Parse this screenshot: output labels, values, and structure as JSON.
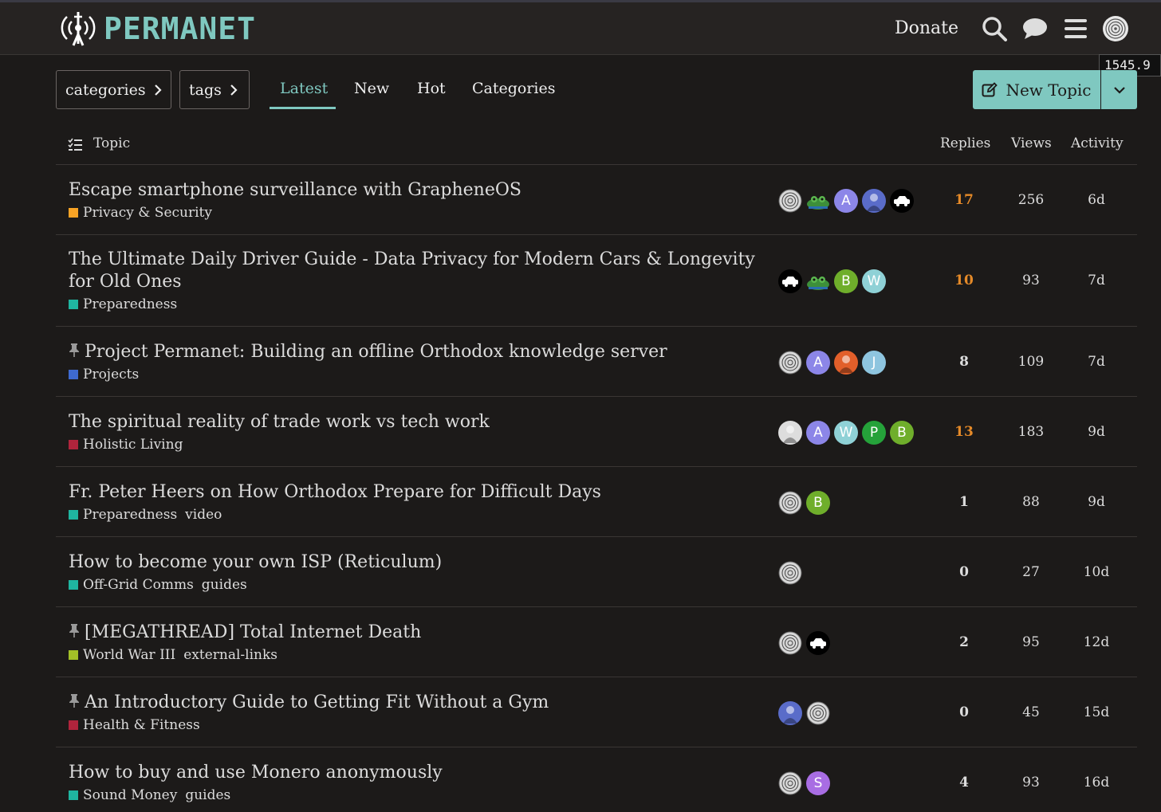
{
  "site": {
    "name": "PERMANET",
    "donate": "Donate",
    "tooltip": "1545.9"
  },
  "nav": {
    "categories_label": "categories",
    "tags_label": "tags",
    "tabs": [
      "Latest",
      "New",
      "Hot",
      "Categories"
    ],
    "active_tab": "Latest",
    "new_topic": "New Topic"
  },
  "table": {
    "headers": {
      "topic": "Topic",
      "replies": "Replies",
      "views": "Views",
      "activity": "Activity"
    },
    "topics": [
      {
        "title": "Escape smartphone surveillance with GrapheneOS",
        "category": "Privacy & Security",
        "cat_color": "#f7a325",
        "tags": [],
        "pinned": false,
        "replies": "17",
        "views": "256",
        "activity": "6d",
        "hot": true,
        "posters": [
          {
            "kind": "fp"
          },
          {
            "kind": "frog"
          },
          {
            "kind": "letter",
            "l": "A",
            "c": "#8c86e8"
          },
          {
            "kind": "img",
            "c": "#5a6cc9"
          },
          {
            "kind": "car"
          }
        ]
      },
      {
        "title": "The Ultimate Daily Driver Guide - Data Privacy for Modern Cars & Longevity for Old Ones",
        "category": "Preparedness",
        "cat_color": "#1fb5a0",
        "tags": [],
        "pinned": false,
        "replies": "10",
        "views": "93",
        "activity": "7d",
        "hot": true,
        "posters": [
          {
            "kind": "car"
          },
          {
            "kind": "frog"
          },
          {
            "kind": "letter",
            "l": "B",
            "c": "#6fae2b"
          },
          {
            "kind": "letter",
            "l": "W",
            "c": "#8fd1d6"
          }
        ]
      },
      {
        "title": "Project Permanet: Building an offline Orthodox knowledge server",
        "category": "Projects",
        "cat_color": "#3e6ad0",
        "tags": [],
        "pinned": true,
        "replies": "8",
        "views": "109",
        "activity": "7d",
        "hot": false,
        "posters": [
          {
            "kind": "fp"
          },
          {
            "kind": "letter",
            "l": "A",
            "c": "#8c86e8"
          },
          {
            "kind": "img",
            "c": "#e25f2a"
          },
          {
            "kind": "letter",
            "l": "J",
            "c": "#8ec5df"
          }
        ]
      },
      {
        "title": "The spiritual reality of trade work vs tech work",
        "category": "Holistic Living",
        "cat_color": "#b0243c",
        "tags": [],
        "pinned": false,
        "replies": "13",
        "views": "183",
        "activity": "9d",
        "hot": true,
        "posters": [
          {
            "kind": "img",
            "c": "#ddd"
          },
          {
            "kind": "letter",
            "l": "A",
            "c": "#8c86e8"
          },
          {
            "kind": "letter",
            "l": "W",
            "c": "#8fd1d6"
          },
          {
            "kind": "letter",
            "l": "P",
            "c": "#25a23a"
          },
          {
            "kind": "letter",
            "l": "B",
            "c": "#6fae2b"
          }
        ]
      },
      {
        "title": "Fr. Peter Heers on How Orthodox Prepare for Difficult Days",
        "category": "Preparedness",
        "cat_color": "#1fb5a0",
        "tags": [
          "video"
        ],
        "pinned": false,
        "replies": "1",
        "views": "88",
        "activity": "9d",
        "hot": false,
        "posters": [
          {
            "kind": "fp"
          },
          {
            "kind": "letter",
            "l": "B",
            "c": "#6fae2b"
          }
        ]
      },
      {
        "title": "How to become your own ISP (Reticulum)",
        "category": "Off-Grid Comms",
        "cat_color": "#1fb5a0",
        "tags": [
          "guides"
        ],
        "pinned": false,
        "replies": "0",
        "views": "27",
        "activity": "10d",
        "hot": false,
        "posters": [
          {
            "kind": "fp"
          }
        ]
      },
      {
        "title": "[MEGATHREAD] Total Internet Death",
        "category": "World War III",
        "cat_color": "#a3c027",
        "tags": [
          "external-links"
        ],
        "pinned": true,
        "replies": "2",
        "views": "95",
        "activity": "12d",
        "hot": false,
        "posters": [
          {
            "kind": "fp"
          },
          {
            "kind": "car"
          }
        ]
      },
      {
        "title": "An Introductory Guide to Getting Fit Without a Gym",
        "category": "Health & Fitness",
        "cat_color": "#b0243c",
        "tags": [],
        "pinned": true,
        "replies": "0",
        "views": "45",
        "activity": "15d",
        "hot": false,
        "posters": [
          {
            "kind": "img",
            "c": "#5a6cc9"
          },
          {
            "kind": "fp"
          }
        ]
      },
      {
        "title": "How to buy and use Monero anonymously",
        "category": "Sound Money",
        "cat_color": "#1fb5a0",
        "tags": [
          "guides"
        ],
        "pinned": false,
        "replies": "4",
        "views": "93",
        "activity": "16d",
        "hot": false,
        "posters": [
          {
            "kind": "fp"
          },
          {
            "kind": "letter",
            "l": "S",
            "c": "#a86de3"
          }
        ]
      }
    ]
  }
}
